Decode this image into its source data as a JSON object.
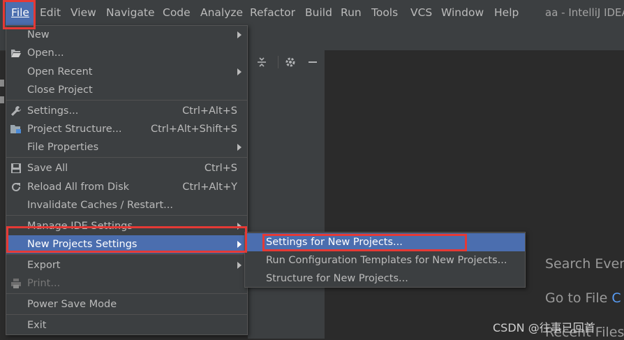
{
  "menubar": {
    "items": [
      {
        "label": "File",
        "mn": "F",
        "rest": "ile"
      },
      {
        "label": "Edit",
        "mn": "E",
        "rest": "dit"
      },
      {
        "label": "View",
        "mn": "V",
        "rest": "iew"
      },
      {
        "label": "Navigate",
        "mn": "N",
        "rest": "avigate"
      },
      {
        "label": "Code",
        "mn": "C",
        "rest": "ode"
      },
      {
        "label": "Analyze",
        "mn": "",
        "rest": "Analyze"
      },
      {
        "label": "Refactor",
        "mn": "R",
        "rest": "efactor"
      },
      {
        "label": "Build",
        "mn": "B",
        "rest": "uild"
      },
      {
        "label": "Run",
        "mn": "R",
        "rest": "un"
      },
      {
        "label": "Tools",
        "mn": "T",
        "rest": "ools"
      },
      {
        "label": "VCS",
        "mn": "",
        "rest": "VCS"
      },
      {
        "label": "Window",
        "mn": "W",
        "rest": "indow"
      },
      {
        "label": "Help",
        "mn": "H",
        "rest": "elp"
      }
    ],
    "window_title": "aa - IntelliJ IDEA"
  },
  "file_menu": {
    "new": "New",
    "open": "Open...",
    "open_recent": "Open Recent",
    "close_project": "Close Project",
    "settings": "Settings...",
    "settings_shortcut": "Ctrl+Alt+S",
    "project_structure": "Project Structure...",
    "project_structure_shortcut": "Ctrl+Alt+Shift+S",
    "file_properties": "File Properties",
    "save_all": "Save All",
    "save_all_shortcut": "Ctrl+S",
    "reload": "Reload All from Disk",
    "reload_shortcut": "Ctrl+Alt+Y",
    "invalidate": "Invalidate Caches / Restart...",
    "manage_ide": "Manage IDE Settings",
    "new_projects_settings": "New Projects Settings",
    "export": "Export",
    "print": "Print...",
    "power_save": "Power Save Mode",
    "exit": "Exit"
  },
  "submenu": {
    "settings_new": "Settings for New Projects...",
    "run_config": "Run Configuration Templates for New Projects...",
    "structure_new": "Structure for New Projects..."
  },
  "editor": {
    "search_everywhere": "Search Every",
    "go_to_file": "Go to File",
    "go_to_file_key": "C",
    "recent_files": "Recent Files"
  },
  "icons": {
    "collapse": "collapse-all-icon",
    "gear": "gear-icon",
    "minimize": "minimize-icon"
  },
  "watermark": "CSDN @往事已回首",
  "colors": {
    "highlight": "#4b6eaf",
    "annotation": "#e53935"
  }
}
